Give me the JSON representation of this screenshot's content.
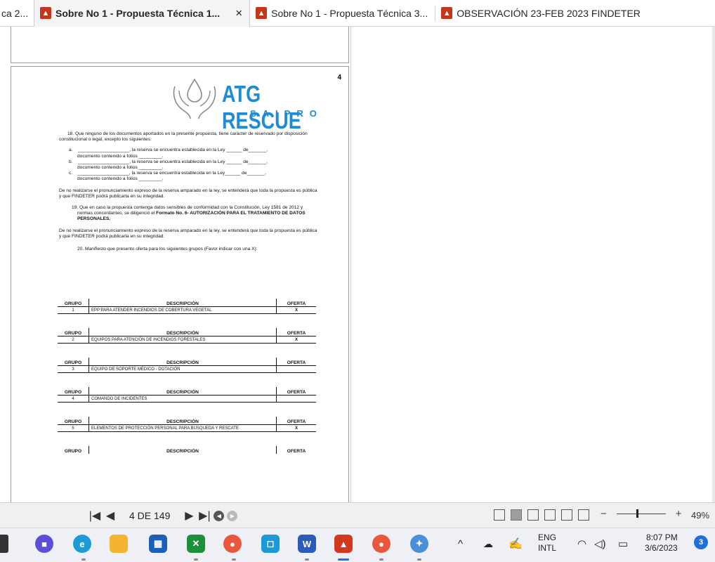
{
  "tabs": [
    {
      "label": "ca 2...",
      "active": false
    },
    {
      "label": "Sobre No 1 - Propuesta Técnica 1...",
      "active": true
    },
    {
      "label": "Sobre No 1 - Propuesta Técnica 3...",
      "active": false
    },
    {
      "label": "OBSERVACIÓN 23-FEB 2023 FINDETER",
      "active": false
    }
  ],
  "tab_close_glyph": "×",
  "page": {
    "number": "4",
    "logo_main": "ATG RESCUE",
    "logo_sub": "SAIPRO",
    "item18": "18. Que ninguno de los documentos aportados en la presente propuesta, tiene carácter de reservado por disposición constitucional o legal, excepto los siguientes:",
    "reserves": [
      {
        "letter": "a.",
        "line1": "____________________, la reserva se encuentra establecida en la Ley ______ de_______,",
        "line2": "documento contenido a folios _________."
      },
      {
        "letter": "b.",
        "line1": "____________________, la reserva se encuentra establecida en la Ley ______ de_______,",
        "line2": "documento contenido a folios _________."
      },
      {
        "letter": "c.",
        "line1": "____________________, la reserva se encuentra establecida en la Ley______ de_______,",
        "line2": "documento contenido a folios _________."
      }
    ],
    "para1": "De no realizarse el pronunciamiento expreso de la reserva amparado en la ley, se entenderá que toda la propuesta es pública y que FINDETER podrá publicarla en su integridad.",
    "item19_a": "19. Que en caso la propuesta contenga datos sensibles de conformidad con la Constitución, Ley 1581 de 2012 y normas concordantes, se diligenció el",
    "item19_b": "Formato No. 6- AUTORIZACIÓN PARA EL TRATAMIENTO DE DATOS PERSONALES.",
    "para2": "De no realizarse el pronunciamiento expreso de la reserva amparado en la ley, se entenderá que toda la propuesta es pública y que FINDETER podrá publicarla en su integridad.",
    "item20": "20. Manifiesto que presento oferta para los siguientes grupos (Favor indicar con una X):",
    "table_headers": {
      "grupo": "GRUPO",
      "descripcion": "DESCRIPCIÓN",
      "oferta": "OFERTA"
    },
    "groups": [
      {
        "num": "1",
        "desc": "EPP PARA ATENDER INCENDIOS DE COBERTURA VEGETAL",
        "oferta": "X"
      },
      {
        "num": "2",
        "desc": "EQUIPOS PARA ATENCIÓN DE INCENDIOS FORESTALES",
        "oferta": "X"
      },
      {
        "num": "3",
        "desc": "EQUIPO DE SOPORTE MÉDICO - DOTACIÓN",
        "oferta": ""
      },
      {
        "num": "4",
        "desc": "COMANDO DE INCIDENTES",
        "oferta": ""
      },
      {
        "num": "5",
        "desc": "ELEMENTOS DE PROTECCIÓN PERSONAL PARA BUSQUEDA Y RESCATE",
        "oferta": "X"
      }
    ]
  },
  "statusbar": {
    "page_info": "4 DE 149",
    "zoom_minus": "−",
    "zoom_plus": "+",
    "zoom_percent": "49%",
    "zoom_level": 0.49
  },
  "taskbar": {
    "tray_chevron": "^",
    "lang_1": "ENG",
    "lang_2": "INTL",
    "time": "8:07 PM",
    "date": "3/6/2023",
    "notifications": "3"
  },
  "colors": {
    "accent_blue": "#1e8bd4",
    "pdf_red": "#c4361b",
    "taskbar_active": "#1a73d9"
  }
}
